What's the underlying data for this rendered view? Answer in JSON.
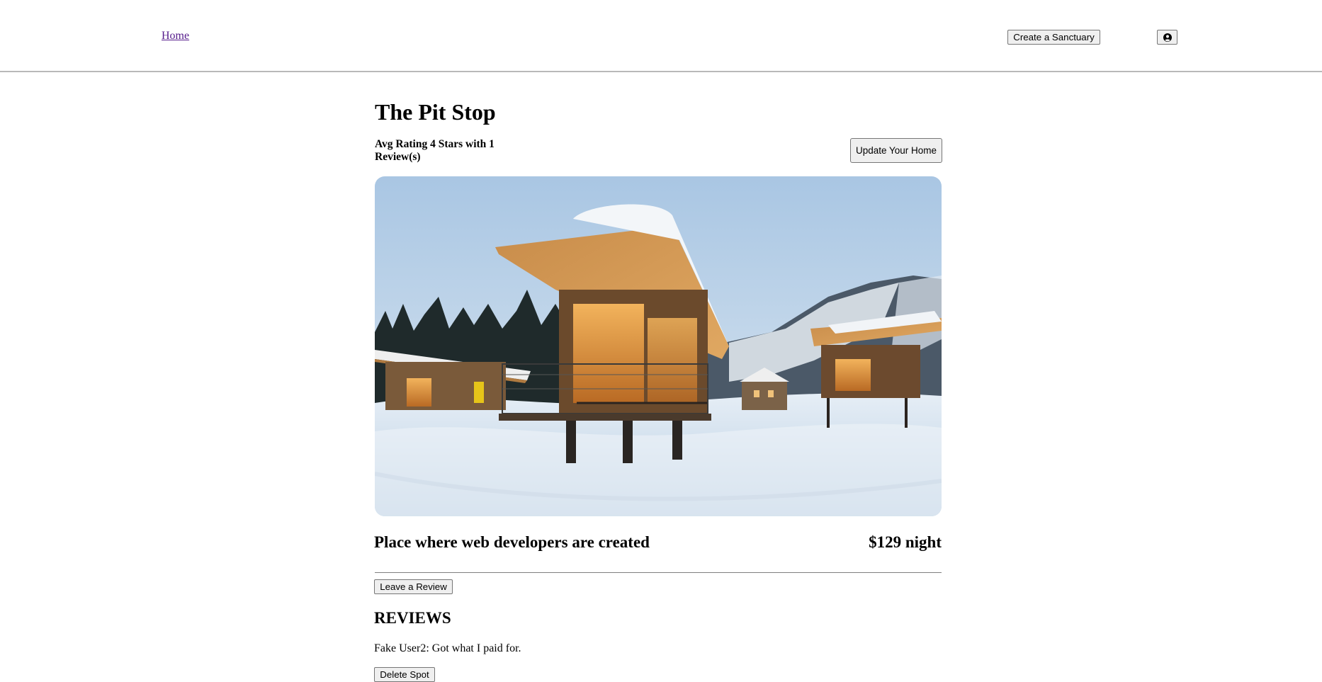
{
  "nav": {
    "home_label": "Home",
    "create_label": "Create a Sanctuary",
    "profile_icon": "user-circle-icon"
  },
  "spot": {
    "title": "The Pit Stop",
    "rating_text": "Avg Rating 4 Stars with 1 Review(s)",
    "update_label": "Update Your Home",
    "description": "Place where web developers are created",
    "price": "$129 night",
    "leave_review_label": "Leave a Review"
  },
  "reviews": {
    "heading": "REVIEWS",
    "items": [
      {
        "text": "Fake User2: Got what I paid for.",
        "delete_label": "Delete Spot"
      }
    ]
  },
  "colors": {
    "link_visited": "#551a8b",
    "button_bg": "#efefef",
    "button_border": "#767676",
    "divider": "#7f7f7f"
  }
}
